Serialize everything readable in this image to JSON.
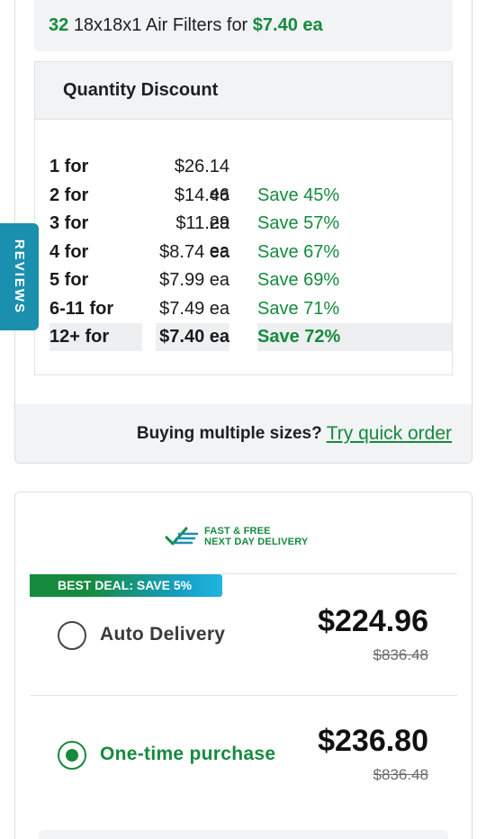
{
  "summary": {
    "qty": "32",
    "product": "18x18x1 Air Filters for",
    "price": "$7.40 ea"
  },
  "quantity_discount": {
    "title": "Quantity Discount",
    "rows": [
      {
        "qty": "1 for",
        "price": "$26.14 ea",
        "save": ""
      },
      {
        "qty": "2 for",
        "price": "$14.46 ea",
        "save": "Save 45%"
      },
      {
        "qty": "3 for",
        "price": "$11.29 ea",
        "save": "Save 57%"
      },
      {
        "qty": "4 for",
        "price": "$8.74 ea",
        "save": "Save 67%"
      },
      {
        "qty": "5 for",
        "price": "$7.99 ea",
        "save": "Save 69%"
      },
      {
        "qty": "6-11 for",
        "price": "$7.49 ea",
        "save": "Save 71%"
      },
      {
        "qty": "12+ for",
        "price": "$7.40 ea",
        "save": "Save 72%"
      }
    ]
  },
  "quick_order": {
    "label": "Buying multiple sizes?",
    "link": "Try quick order"
  },
  "delivery": {
    "line1": "FAST & FREE",
    "line2": "NEXT DAY DELIVERY"
  },
  "purchase_options": {
    "deal_tag": "BEST DEAL: SAVE 5%",
    "auto": {
      "label": "Auto Delivery",
      "price": "$224.96",
      "original": "$836.48",
      "selected": false
    },
    "onetime": {
      "label": "One-time purchase",
      "price": "$236.80",
      "original": "$836.48",
      "selected": true
    }
  },
  "reviews_tab": "REVIEWS",
  "colors": {
    "accent_green": "#168a3e",
    "reviews_teal": "#1a8fae",
    "panel_grey": "#f1f3f4"
  }
}
